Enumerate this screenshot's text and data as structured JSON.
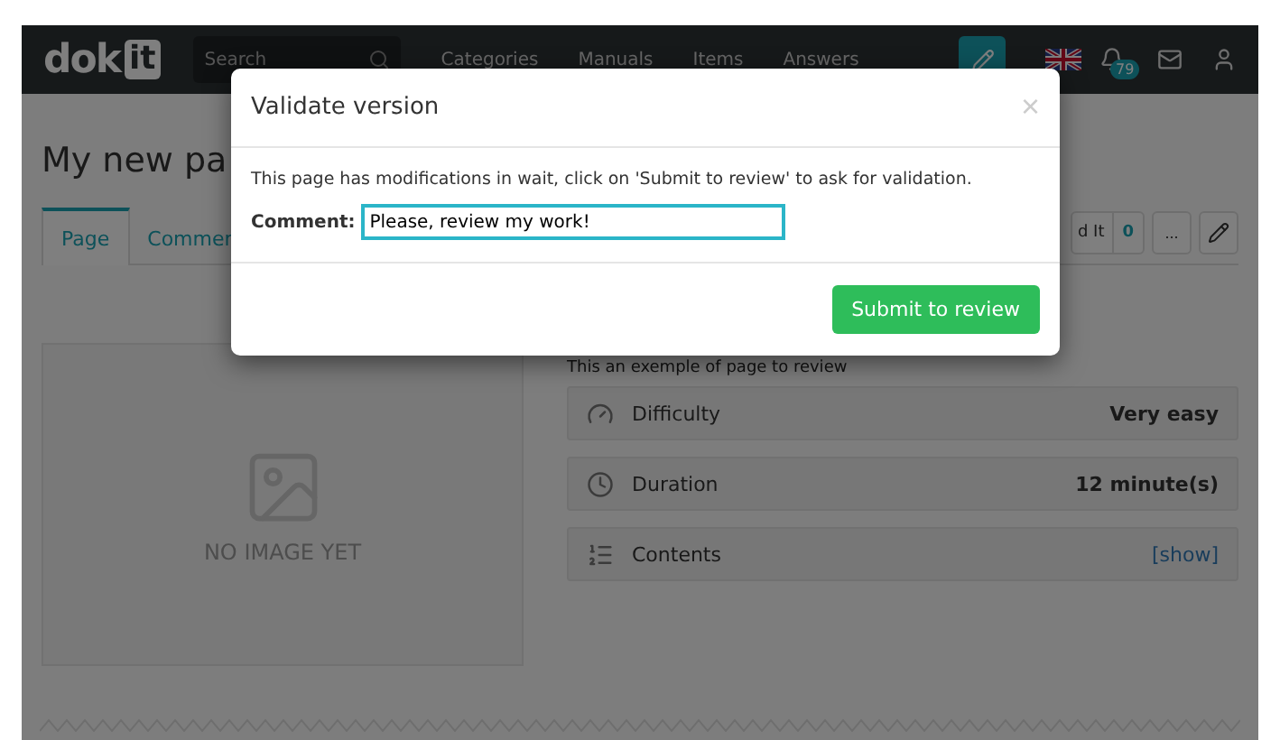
{
  "navbar": {
    "logo": {
      "text": "dok",
      "badge": "it"
    },
    "search": {
      "placeholder": "Search"
    },
    "links": [
      "Categories",
      "Manuals",
      "Items",
      "Answers"
    ],
    "notifications": "79"
  },
  "page": {
    "title": "My new pa",
    "tabs": [
      {
        "label": "Page",
        "selected": true
      },
      {
        "label": "Commer",
        "selected": false
      }
    ],
    "actions": {
      "follow_label": "d It",
      "follow_count": "0",
      "more": "..."
    },
    "image_placeholder": "NO IMAGE YET",
    "intro": "This an exemple of page to review",
    "details": [
      {
        "kind": "difficulty",
        "label": "Difficulty",
        "value": "Very easy"
      },
      {
        "kind": "duration",
        "label": "Duration",
        "value": "12 minute(s)"
      },
      {
        "kind": "contents",
        "label": "Contents",
        "link": "[show]"
      }
    ]
  },
  "modal": {
    "title": "Validate version",
    "close": "×",
    "message": "This page has modifications in wait, click on 'Submit to review' to ask for validation.",
    "comment_label": "Comment:",
    "comment_value": "Please, review my work!",
    "submit": "Submit to review"
  }
}
